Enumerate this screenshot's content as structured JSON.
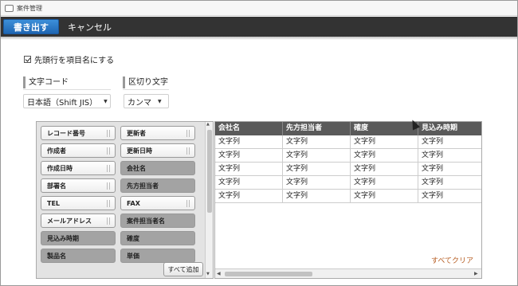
{
  "window": {
    "title": "案件管理"
  },
  "toolbar": {
    "export_label": "書き出す",
    "cancel_label": "キャンセル"
  },
  "options": {
    "header_row_label": "先頭行を項目名にする",
    "header_row_checked": true
  },
  "encoding": {
    "label": "文字コード",
    "value": "日本語（Shift JIS）"
  },
  "delimiter": {
    "label": "区切り文字",
    "value": "カンマ"
  },
  "available_fields": {
    "items": [
      {
        "label": "レコード番号",
        "active": true
      },
      {
        "label": "更新者",
        "active": true
      },
      {
        "label": "作成者",
        "active": true
      },
      {
        "label": "更新日時",
        "active": true
      },
      {
        "label": "作成日時",
        "active": true
      },
      {
        "label": "会社名",
        "active": false
      },
      {
        "label": "部署名",
        "active": true
      },
      {
        "label": "先方担当者",
        "active": false
      },
      {
        "label": "TEL",
        "active": true
      },
      {
        "label": "FAX",
        "active": true
      },
      {
        "label": "メールアドレス",
        "active": true
      },
      {
        "label": "案件担当者名",
        "active": false
      },
      {
        "label": "見込み時期",
        "active": false
      },
      {
        "label": "確度",
        "active": false
      },
      {
        "label": "製品名",
        "active": false
      },
      {
        "label": "単価",
        "active": false
      }
    ],
    "add_all_label": "すべて追加"
  },
  "preview": {
    "columns": [
      "会社名",
      "先方担当者",
      "確度",
      "見込み時期"
    ],
    "rows": [
      [
        "文字列",
        "文字列",
        "文字列",
        "文字列"
      ],
      [
        "文字列",
        "文字列",
        "文字列",
        "文字列"
      ],
      [
        "文字列",
        "文字列",
        "文字列",
        "文字列"
      ],
      [
        "文字列",
        "文字列",
        "文字列",
        "文字列"
      ],
      [
        "文字列",
        "文字列",
        "文字列",
        "文字列"
      ]
    ],
    "clear_all_label": "すべてクリア"
  },
  "colors": {
    "toolbar": "#333333",
    "primary_button": "#1f66b3",
    "link_orange": "#b55a1e"
  }
}
